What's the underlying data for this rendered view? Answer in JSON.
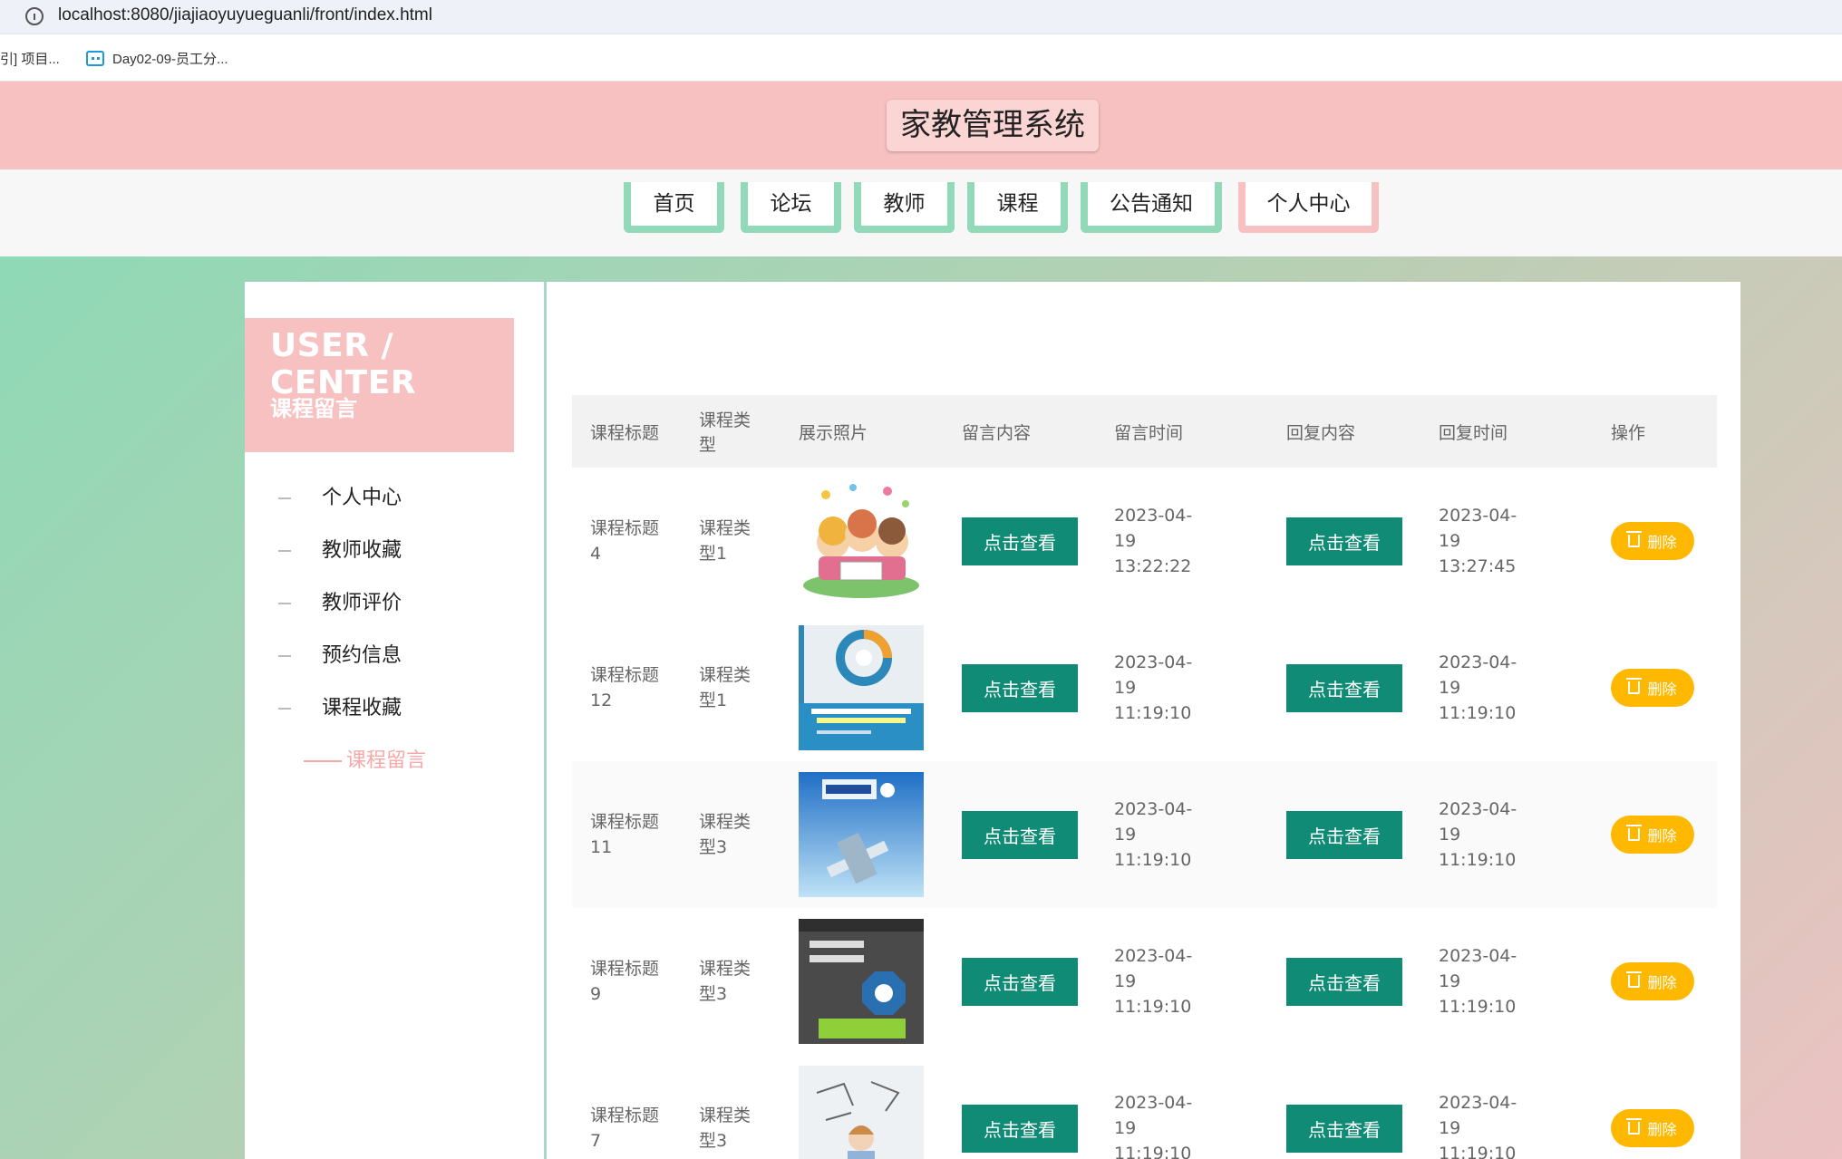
{
  "browser": {
    "url": "localhost:8080/jiajiaoyuyueguanli/front/index.html",
    "bookmarks": [
      "引] 项目...",
      "Day02-09-员工分..."
    ]
  },
  "site": {
    "title": "家教管理系统"
  },
  "nav": {
    "items": [
      "首页",
      "论坛",
      "教师",
      "课程",
      "公告通知",
      "个人中心"
    ],
    "active": "个人中心"
  },
  "sidebar": {
    "title": "USER / CENTER",
    "subtitle": "课程留言",
    "items": [
      "个人中心",
      "教师收藏",
      "教师评价",
      "预约信息",
      "课程收藏",
      "课程留言"
    ],
    "active": "课程留言"
  },
  "table": {
    "headers": [
      "课程标题",
      "课程类型",
      "展示照片",
      "留言内容",
      "留言时间",
      "回复内容",
      "回复时间",
      "操作"
    ],
    "view_label": "点击查看",
    "delete_label": "删除",
    "rows": [
      {
        "title": "课程标题 4",
        "type": "课程类型1",
        "photo": "children-illustration",
        "msg_time": "2023-04-19 13:22:22",
        "reply_time": "2023-04-19 13:27:45"
      },
      {
        "title": "课程标题 12",
        "type": "课程类型1",
        "photo": "java-book-cover",
        "msg_time": "2023-04-19 11:19:10",
        "reply_time": "2023-04-19 11:19:10"
      },
      {
        "title": "课程标题 11",
        "type": "课程类型3",
        "photo": "physics-book-cover",
        "msg_time": "2023-04-19 11:19:10",
        "reply_time": "2023-04-19 11:19:10"
      },
      {
        "title": "课程标题 9",
        "type": "课程类型3",
        "photo": "math-book-cover",
        "msg_time": "2023-04-19 11:19:10",
        "reply_time": "2023-04-19 11:19:10"
      },
      {
        "title": "课程标题 7",
        "type": "课程类型3",
        "photo": "student-sketch",
        "msg_time": "2023-04-19 11:19:10",
        "reply_time": "2023-04-19 11:19:10"
      }
    ]
  },
  "colors": {
    "header_pink": "#f7c1c1",
    "nav_green": "#91d9b8",
    "view_button": "#108b76",
    "delete_button": "#ffb800"
  }
}
